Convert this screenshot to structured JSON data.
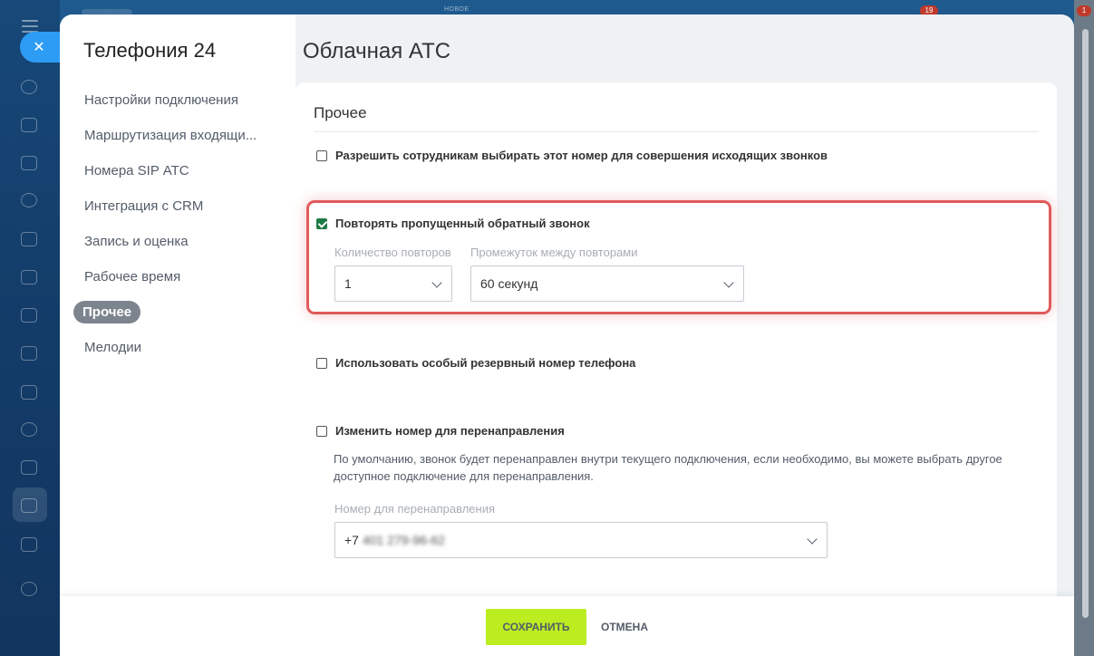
{
  "topbar": {
    "new_label": "НОВОЕ",
    "badge_counter_1": "19",
    "badge_counter_2": "1"
  },
  "app_title": "Телефония 24",
  "page_title": "Облачная АТС",
  "nav": {
    "items": [
      {
        "label": "Настройки подключения"
      },
      {
        "label": "Маршрутизация входящи..."
      },
      {
        "label": "Номера SIP АТС"
      },
      {
        "label": "Интеграция с CRM"
      },
      {
        "label": "Запись и оценка"
      },
      {
        "label": "Рабочее время"
      },
      {
        "label": "Прочее",
        "active": true
      },
      {
        "label": "Мелодии"
      }
    ]
  },
  "section": {
    "title": "Прочее",
    "allow_outgoing": {
      "label": "Разрешить сотрудникам выбирать этот номер для совершения исходящих звонков",
      "checked": false
    },
    "repeat_callback": {
      "label": "Повторять пропущенный обратный звонок",
      "checked": true,
      "repeat_count": {
        "label": "Количество повторов",
        "value": "1"
      },
      "repeat_interval": {
        "label": "Промежуток между повторами",
        "value": "60 секунд"
      }
    },
    "backup_number": {
      "label": "Использовать особый резервный номер телефона",
      "checked": false
    },
    "change_redirect": {
      "label": "Изменить номер для перенаправления",
      "checked": false,
      "description": "По умолчанию, звонок будет перенаправлен внутри текущего подключения, если необходимо, вы можете выбрать другое доступное подключение для перенаправления.",
      "redirect_number": {
        "label": "Номер для перенаправления",
        "prefix": "+7",
        "masked": "401 279-96-62"
      }
    }
  },
  "footer": {
    "save_label": "СОХРАНИТЬ",
    "cancel_label": "ОТМЕНА"
  },
  "colors": {
    "accent_save": "#bbed21",
    "highlight": "#e05a5a",
    "checkbox_checked": "#1e7a46",
    "close_button": "#2d9cf5"
  }
}
